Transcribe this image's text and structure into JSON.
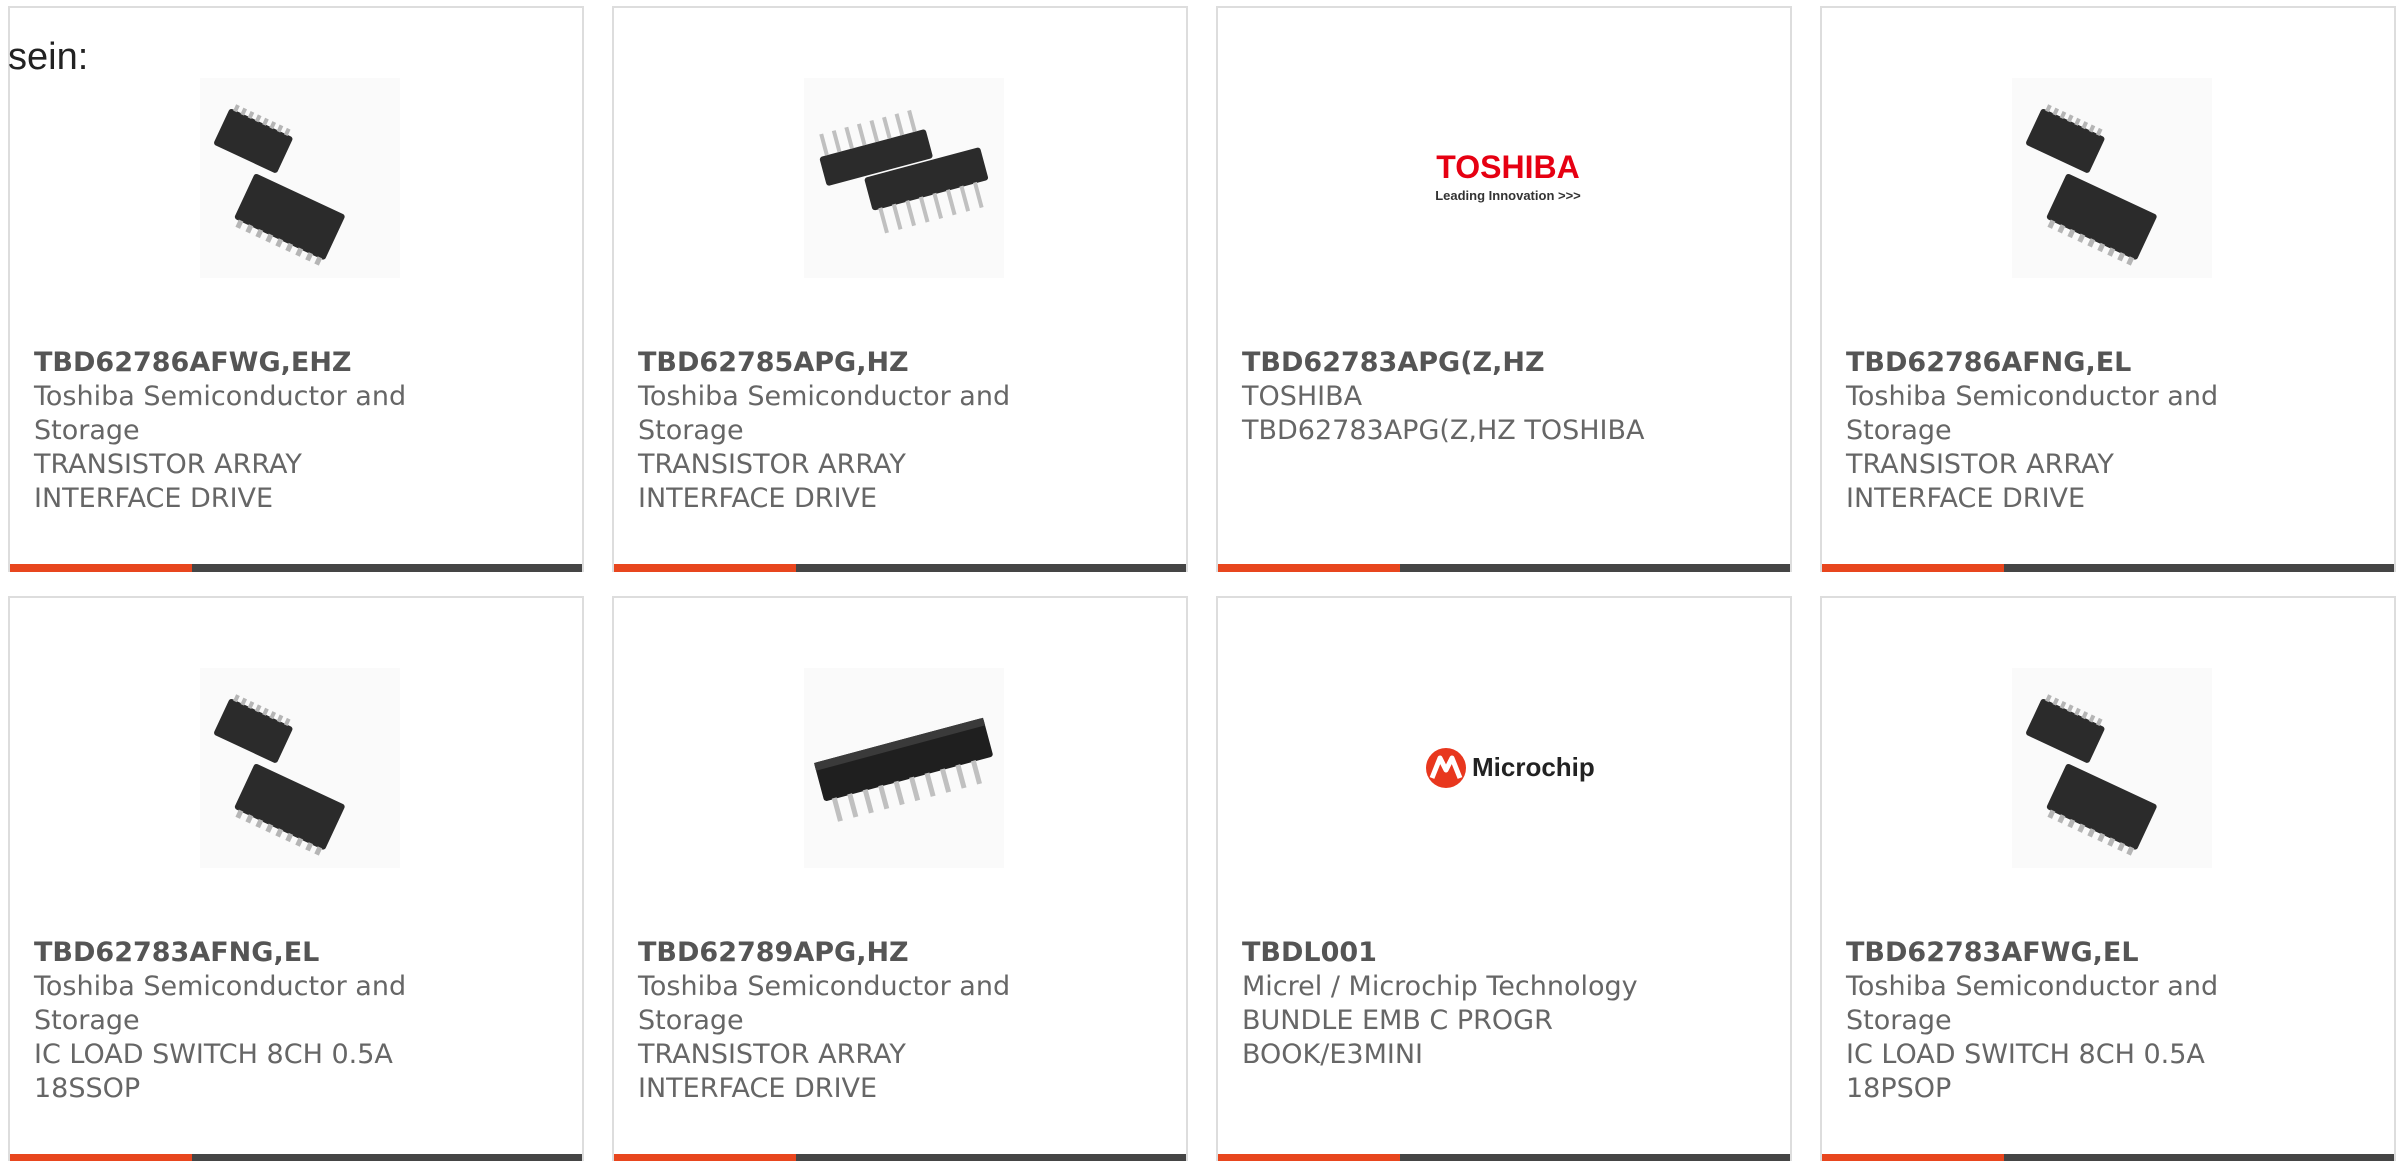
{
  "intro_text": "sein:",
  "colors": {
    "accent": "#e8461e",
    "bar": "#454545",
    "border": "#dddddd",
    "text": "#666666",
    "title": "#555555",
    "toshiba_red": "#e60012"
  },
  "products": [
    {
      "part": "TBD62786AFWG,EHZ",
      "manufacturer": "Toshiba Semiconductor and Storage",
      "description": "TRANSISTOR ARRAY INTERFACE DRIVE",
      "image": "soic-chip-icon"
    },
    {
      "part": "TBD62785APG,HZ",
      "manufacturer": "Toshiba Semiconductor and Storage",
      "description": "TRANSISTOR ARRAY INTERFACE DRIVE",
      "image": "dip-chip-icon"
    },
    {
      "part": "TBD62783APG(Z,HZ",
      "manufacturer": "TOSHIBA",
      "description": "TBD62783APG(Z,HZ TOSHIBA",
      "image": "toshiba-logo",
      "logo_text": "TOSHIBA",
      "logo_tagline": "Leading Innovation >>>"
    },
    {
      "part": "TBD62786AFNG,EL",
      "manufacturer": "Toshiba Semiconductor and Storage",
      "description": "TRANSISTOR ARRAY INTERFACE DRIVE",
      "image": "soic-chip-icon"
    },
    {
      "part": "TBD62783AFNG,EL",
      "manufacturer": "Toshiba Semiconductor and Storage",
      "description": "IC LOAD SWITCH 8CH 0.5A 18SSOP",
      "image": "soic-chip-icon"
    },
    {
      "part": "TBD62789APG,HZ",
      "manufacturer": "Toshiba Semiconductor and Storage",
      "description": "TRANSISTOR ARRAY INTERFACE DRIVE",
      "image": "dip-chip-single-icon"
    },
    {
      "part": "TBDL001",
      "manufacturer": "Micrel / Microchip Technology",
      "description": "BUNDLE EMB C PROGR BOOK/E3MINI",
      "image": "microchip-logo",
      "logo_text": "Microchip"
    },
    {
      "part": "TBD62783AFWG,EL",
      "manufacturer": "Toshiba Semiconductor and Storage",
      "description": "IC LOAD SWITCH 8CH 0.5A 18PSOP",
      "image": "soic-chip-icon"
    }
  ]
}
